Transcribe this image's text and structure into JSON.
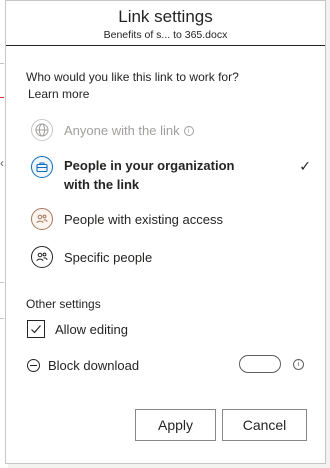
{
  "dialog": {
    "title": "Link settings",
    "subtitle": "Benefits of s... to 365.docx"
  },
  "link_section": {
    "question": "Who would you like this link to work for?",
    "learn_more": "Learn more",
    "options": [
      {
        "label": "Anyone with the link",
        "icon": "globe-icon",
        "state": "disabled",
        "info_icon": "info-icon"
      },
      {
        "label": "People in your organization with the link",
        "icon": "briefcase-icon",
        "state": "selected",
        "selected_mark": "✓"
      },
      {
        "label": "People with existing access",
        "icon": "people-icon",
        "state": "available"
      },
      {
        "label": "Specific people",
        "icon": "specific-people-icon",
        "state": "available"
      }
    ]
  },
  "other_settings": {
    "heading": "Other settings",
    "allow_editing": {
      "label": "Allow editing",
      "checked": true
    },
    "block_download": {
      "label": "Block download",
      "toggle_on": false,
      "info_glyph": "i"
    }
  },
  "buttons": {
    "apply": "Apply",
    "cancel": "Cancel"
  },
  "colors": {
    "selected_accent": "#0f6cbd",
    "existing_access_accent": "#a4775d",
    "disabled_text": "#a19f9d",
    "text": "#252423"
  }
}
